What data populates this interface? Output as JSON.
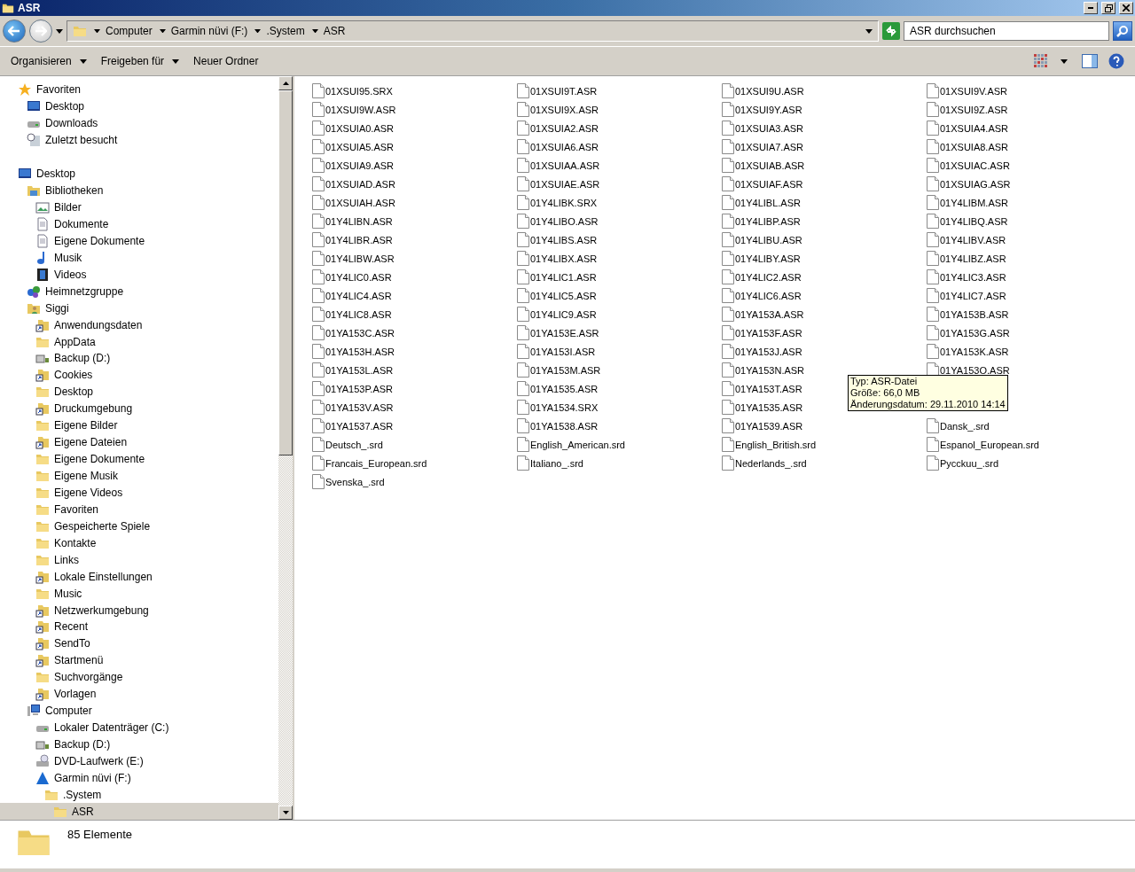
{
  "window": {
    "title": "ASR"
  },
  "address": {
    "crumbs": [
      "Computer",
      "Garmin nüvi (F:)",
      ".System",
      "ASR"
    ],
    "search": {
      "placeholder": "ASR durchsuchen"
    }
  },
  "toolbar": [
    {
      "label": "Organisieren",
      "dropdown": true
    },
    {
      "label": "Freigeben für",
      "dropdown": true
    },
    {
      "label": "Neuer Ordner",
      "dropdown": false
    }
  ],
  "nav_tree": [
    {
      "label": "Favoriten",
      "kind": "star",
      "selected": false,
      "children": [
        {
          "label": "Desktop",
          "kind": "desktop",
          "selected": false
        },
        {
          "label": "Downloads",
          "kind": "drive",
          "selected": false
        },
        {
          "label": "Zuletzt besucht",
          "kind": "recent",
          "selected": false
        }
      ]
    },
    {
      "label": "Desktop",
      "kind": "desktop",
      "selected": false,
      "children": [
        {
          "label": "Bibliotheken",
          "kind": "library",
          "selected": false,
          "children": [
            {
              "label": "Bilder",
              "kind": "pictures",
              "selected": false
            },
            {
              "label": "Dokumente",
              "kind": "document",
              "selected": false
            },
            {
              "label": "Eigene Dokumente",
              "kind": "document",
              "selected": false
            },
            {
              "label": "Musik",
              "kind": "music",
              "selected": false
            },
            {
              "label": "Videos",
              "kind": "video",
              "selected": false
            }
          ]
        },
        {
          "label": "Heimnetzgruppe",
          "kind": "homegroup",
          "selected": false
        },
        {
          "label": "Siggi",
          "kind": "user",
          "selected": false,
          "children": [
            {
              "label": "Anwendungsdaten",
              "kind": "shortcut",
              "selected": false
            },
            {
              "label": "AppData",
              "kind": "folder",
              "selected": false
            },
            {
              "label": "Backup (D:)",
              "kind": "netdrive",
              "selected": false
            },
            {
              "label": "Cookies",
              "kind": "shortcut",
              "selected": false
            },
            {
              "label": "Desktop",
              "kind": "folder",
              "selected": false
            },
            {
              "label": "Druckumgebung",
              "kind": "shortcut",
              "selected": false
            },
            {
              "label": "Eigene Bilder",
              "kind": "folder",
              "selected": false
            },
            {
              "label": "Eigene Dateien",
              "kind": "shortcut",
              "selected": false
            },
            {
              "label": "Eigene Dokumente",
              "kind": "folder",
              "selected": false
            },
            {
              "label": "Eigene Musik",
              "kind": "folder",
              "selected": false
            },
            {
              "label": "Eigene Videos",
              "kind": "folder",
              "selected": false
            },
            {
              "label": "Favoriten",
              "kind": "folder",
              "selected": false
            },
            {
              "label": "Gespeicherte Spiele",
              "kind": "folder",
              "selected": false
            },
            {
              "label": "Kontakte",
              "kind": "folder",
              "selected": false
            },
            {
              "label": "Links",
              "kind": "folder",
              "selected": false
            },
            {
              "label": "Lokale Einstellungen",
              "kind": "shortcut",
              "selected": false
            },
            {
              "label": "Music",
              "kind": "folder",
              "selected": false
            },
            {
              "label": "Netzwerkumgebung",
              "kind": "shortcut",
              "selected": false
            },
            {
              "label": "Recent",
              "kind": "shortcut",
              "selected": false
            },
            {
              "label": "SendTo",
              "kind": "shortcut",
              "selected": false
            },
            {
              "label": "Startmenü",
              "kind": "shortcut",
              "selected": false
            },
            {
              "label": "Suchvorgänge",
              "kind": "folder",
              "selected": false
            },
            {
              "label": "Vorlagen",
              "kind": "shortcut",
              "selected": false
            }
          ]
        },
        {
          "label": "Computer",
          "kind": "computer",
          "selected": false,
          "children": [
            {
              "label": "Lokaler Datenträger (C:)",
              "kind": "drive",
              "selected": false
            },
            {
              "label": "Backup (D:)",
              "kind": "netdrive",
              "selected": false
            },
            {
              "label": "DVD-Laufwerk (E:)",
              "kind": "dvd",
              "selected": false
            },
            {
              "label": "Garmin nüvi (F:)",
              "kind": "garmin",
              "selected": false,
              "children": [
                {
                  "label": ".System",
                  "kind": "folder",
                  "selected": false,
                  "children": [
                    {
                      "label": "ASR",
                      "kind": "folder",
                      "selected": true
                    }
                  ]
                }
              ]
            }
          ]
        }
      ]
    }
  ],
  "file_rows": [
    [
      "01XSUI95.SRX",
      "01XSUI9T.ASR",
      "01XSUI9U.ASR",
      "01XSUI9V.ASR"
    ],
    [
      "01XSUI9W.ASR",
      "01XSUI9X.ASR",
      "01XSUI9Y.ASR",
      "01XSUI9Z.ASR"
    ],
    [
      "01XSUIA0.ASR",
      "01XSUIA2.ASR",
      "01XSUIA3.ASR",
      "01XSUIA4.ASR"
    ],
    [
      "01XSUIA5.ASR",
      "01XSUIA6.ASR",
      "01XSUIA7.ASR",
      "01XSUIA8.ASR"
    ],
    [
      "01XSUIA9.ASR",
      "01XSUIAA.ASR",
      "01XSUIAB.ASR",
      "01XSUIAC.ASR"
    ],
    [
      "01XSUIAD.ASR",
      "01XSUIAE.ASR",
      "01XSUIAF.ASR",
      "01XSUIAG.ASR"
    ],
    [
      "01XSUIAH.ASR",
      "01Y4LIBK.SRX",
      "01Y4LIBL.ASR",
      "01Y4LIBM.ASR"
    ],
    [
      "01Y4LIBN.ASR",
      "01Y4LIBO.ASR",
      "01Y4LIBP.ASR",
      "01Y4LIBQ.ASR"
    ],
    [
      "01Y4LIBR.ASR",
      "01Y4LIBS.ASR",
      "01Y4LIBU.ASR",
      "01Y4LIBV.ASR"
    ],
    [
      "01Y4LIBW.ASR",
      "01Y4LIBX.ASR",
      "01Y4LIBY.ASR",
      "01Y4LIBZ.ASR"
    ],
    [
      "01Y4LIC0.ASR",
      "01Y4LIC1.ASR",
      "01Y4LIC2.ASR",
      "01Y4LIC3.ASR"
    ],
    [
      "01Y4LIC4.ASR",
      "01Y4LIC5.ASR",
      "01Y4LIC6.ASR",
      "01Y4LIC7.ASR"
    ],
    [
      "01Y4LIC8.ASR",
      "01Y4LIC9.ASR",
      "01YA153A.ASR",
      "01YA153B.ASR"
    ],
    [
      "01YA153C.ASR",
      "01YA153E.ASR",
      "01YA153F.ASR",
      "01YA153G.ASR"
    ],
    [
      "01YA153H.ASR",
      "01YA153I.ASR",
      "01YA153J.ASR",
      "01YA153K.ASR"
    ],
    [
      "01YA153L.ASR",
      "01YA153M.ASR",
      "01YA153N.ASR",
      "01YA153O.ASR"
    ],
    [
      "01YA153P.ASR",
      "01YA1535.ASR",
      "01YA153T.ASR",
      null
    ],
    [
      "01YA153V.ASR",
      "01YA1534.SRX",
      "01YA1535.ASR",
      null
    ],
    [
      "01YA1537.ASR",
      "01YA1538.ASR",
      "01YA1539.ASR",
      "Dansk_.srd"
    ],
    [
      "Deutsch_.srd",
      "English_American.srd",
      "English_British.srd",
      "Espanol_European.srd"
    ],
    [
      "Francais_European.srd",
      "Italiano_.srd",
      "Nederlands_.srd",
      "Pycckuu_.srd"
    ],
    [
      "Svenska_.srd"
    ]
  ],
  "tooltip": {
    "lines": [
      "Typ: ASR-Datei",
      "Größe: 66,0 MB",
      "Änderungsdatum: 29.11.2010 14:14"
    ]
  },
  "status_bar": {
    "count": "85 Elemente"
  }
}
